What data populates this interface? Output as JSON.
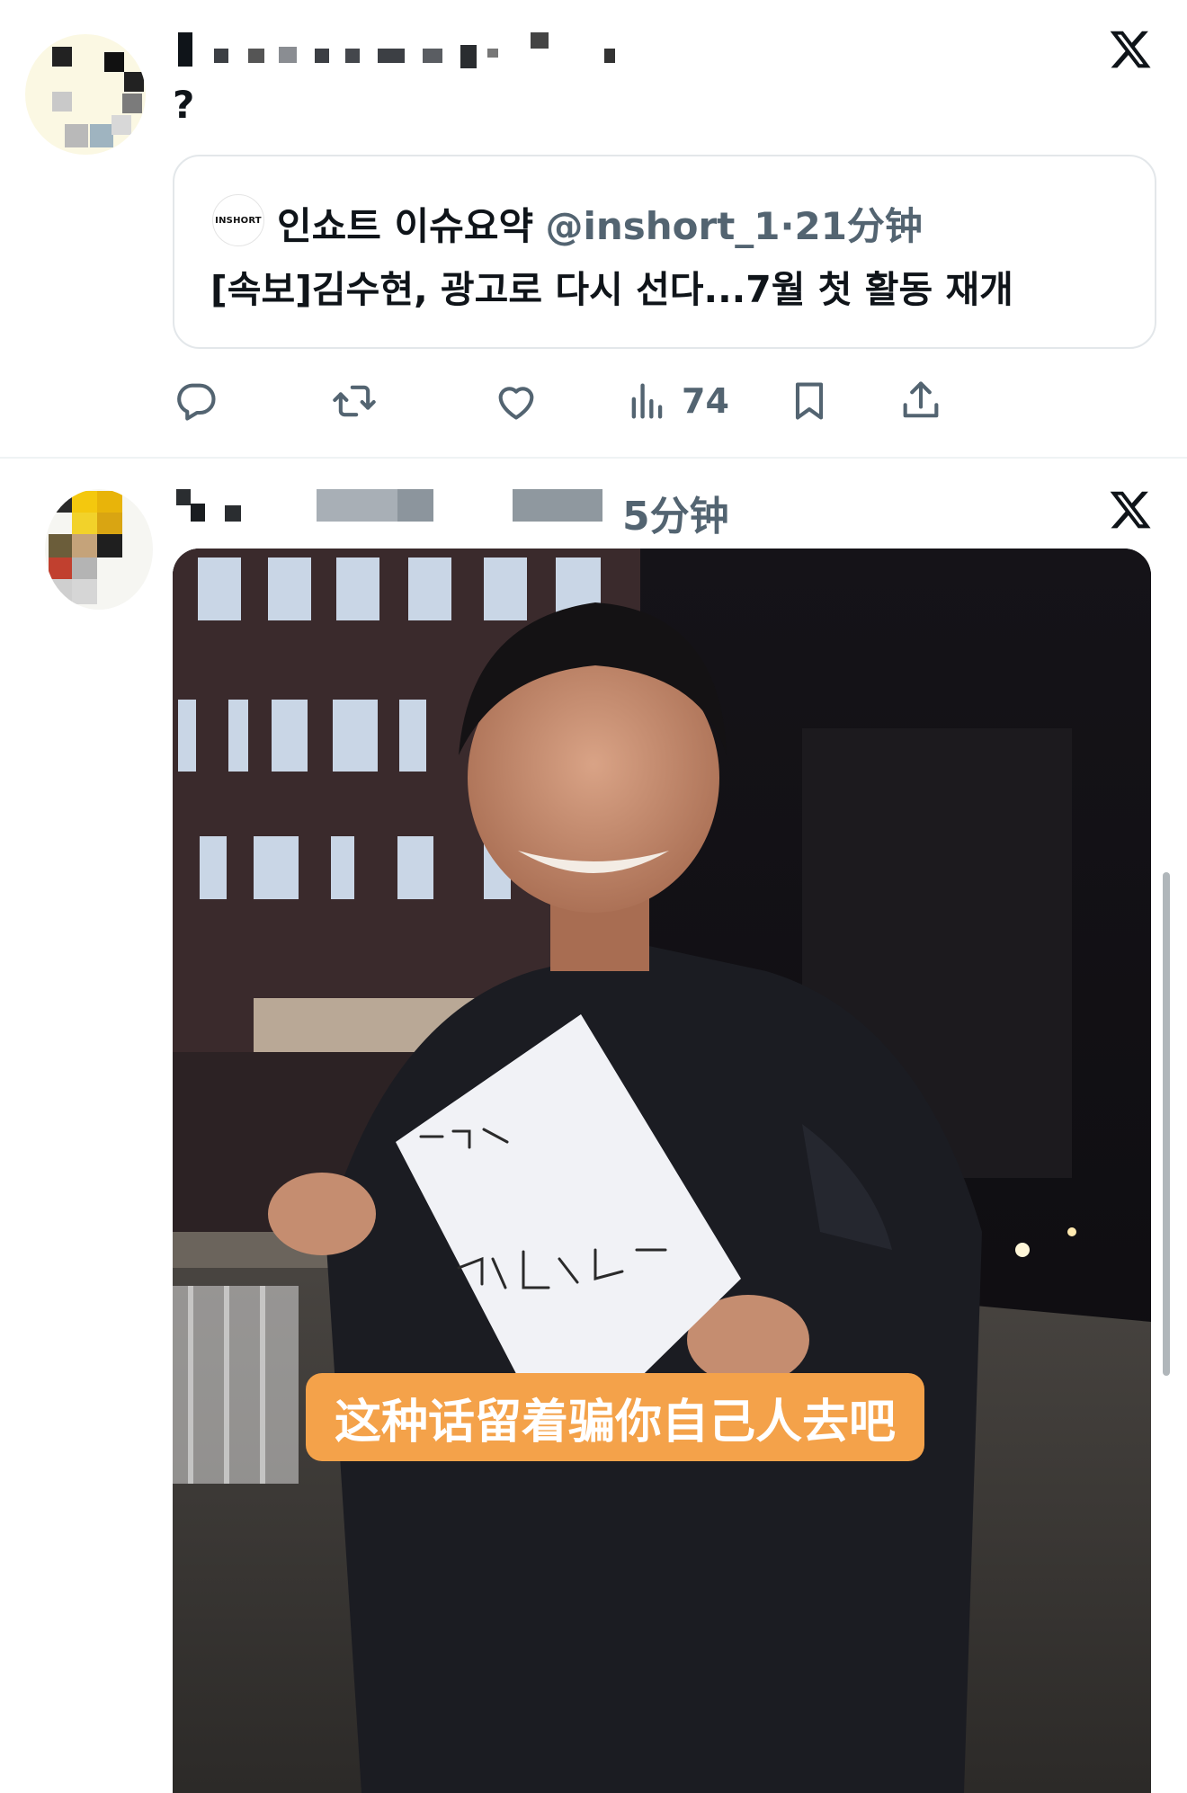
{
  "tweet1": {
    "text": "?",
    "quote": {
      "avatar_label": "INSHORT",
      "author_name": "인쇼트 이슈요약",
      "handle_time": "@inshort_1·21分钟",
      "body": "[속보]김수현, 광고로 다시 선다...7월 첫 활동 재개"
    },
    "actions": {
      "views_count": "74"
    }
  },
  "tweet2": {
    "time": "5分钟",
    "media": {
      "caption": "这种话留着骗你自己人去吧",
      "paper_line1": "그런 건",
      "paper_line2": "가서 말해라"
    }
  },
  "icons": {
    "platform": "x-logo-icon",
    "reply": "reply-icon",
    "repost": "repost-icon",
    "like": "heart-icon",
    "views": "views-icon",
    "bookmark": "bookmark-icon",
    "share": "share-icon"
  },
  "colors": {
    "text": "#0f1419",
    "secondary": "#536471",
    "border": "#e3e7ea",
    "caption_bg": "#f4a24a"
  }
}
